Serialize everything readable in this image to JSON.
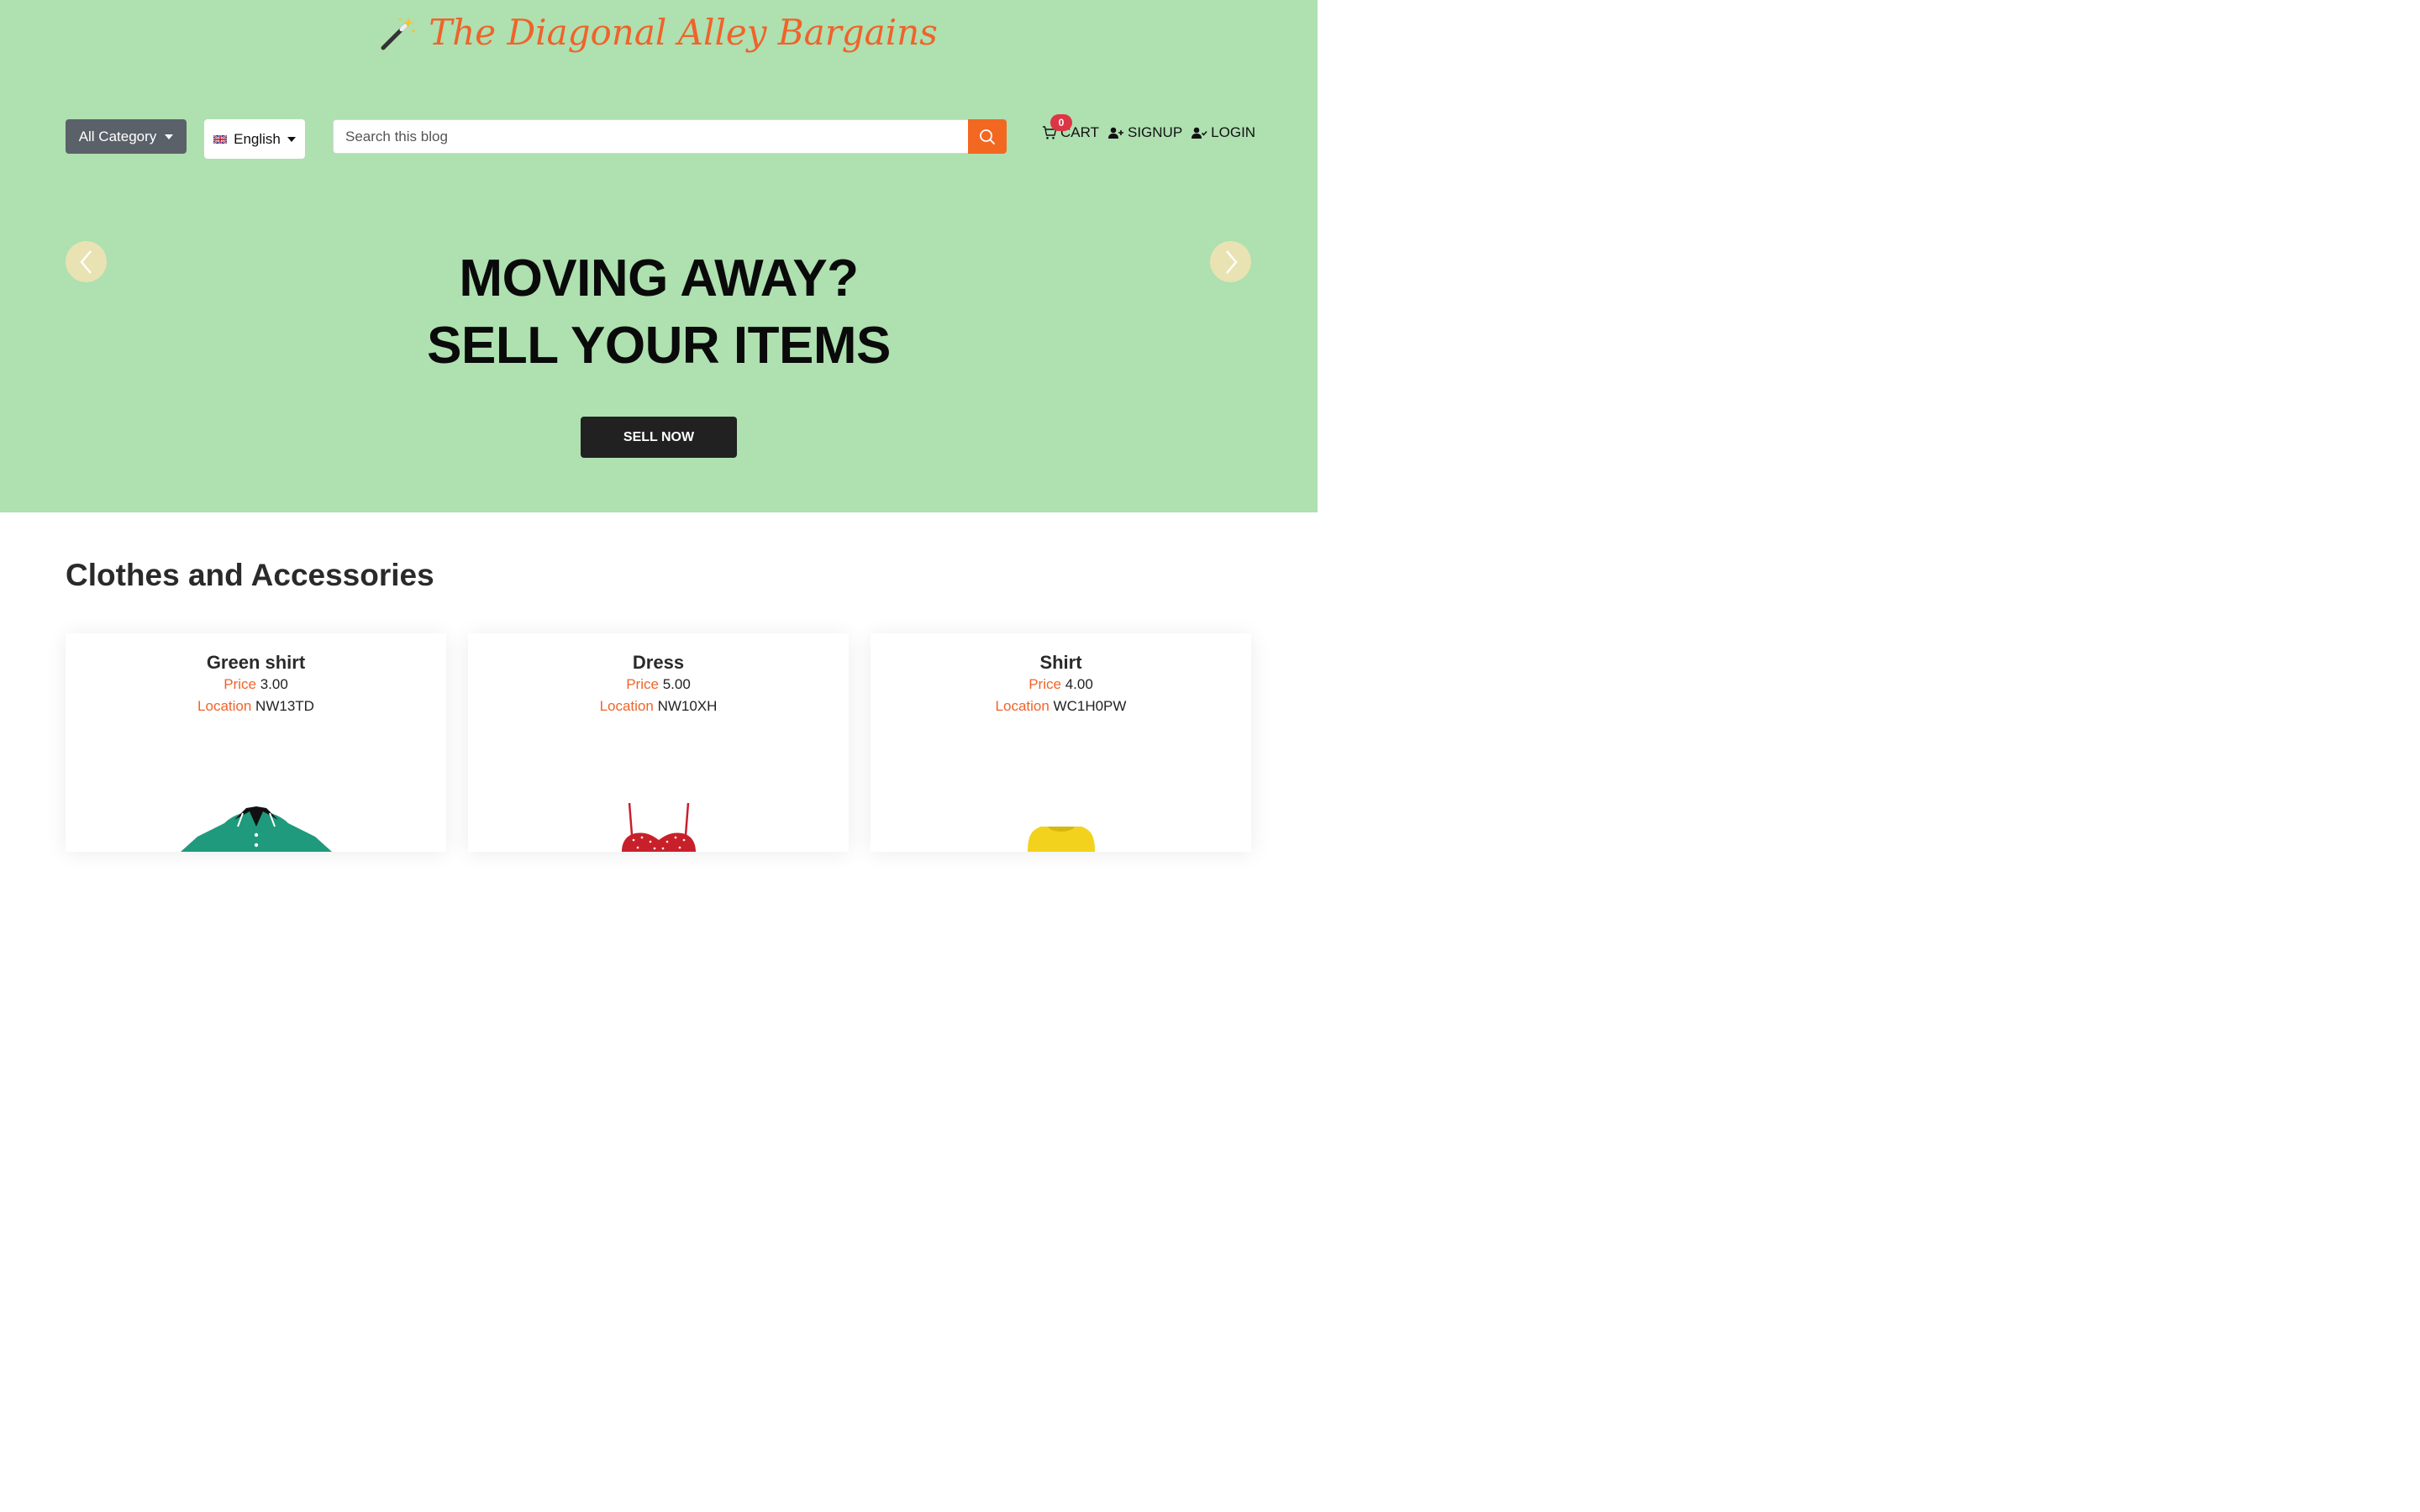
{
  "site": {
    "title": "The Diagonal Alley Bargains",
    "brand_color": "#f0632a",
    "hero_bg": "#aee0b0"
  },
  "toolbar": {
    "category_label": "All Category",
    "language_label": "English",
    "search_placeholder": "Search this blog",
    "cart_label": "CART",
    "cart_count": "0",
    "signup_label": "SIGNUP",
    "login_label": "LOGIN"
  },
  "hero": {
    "line1": "MOVING AWAY?",
    "line2": "SELL YOUR ITEMS",
    "cta_label": "SELL NOW"
  },
  "section": {
    "title": "Clothes and Accessories"
  },
  "products": [
    {
      "name": "Green shirt",
      "price_label": "Price",
      "price": "3.00",
      "location_label": "Location",
      "location": "NW13TD",
      "image_color": "#1f9a7c"
    },
    {
      "name": "Dress",
      "price_label": "Price",
      "price": "5.00",
      "location_label": "Location",
      "location": "NW10XH",
      "image_color": "#c8202a"
    },
    {
      "name": "Shirt",
      "price_label": "Price",
      "price": "4.00",
      "location_label": "Location",
      "location": "WC1H0PW",
      "image_color": "#f2d21c"
    }
  ]
}
